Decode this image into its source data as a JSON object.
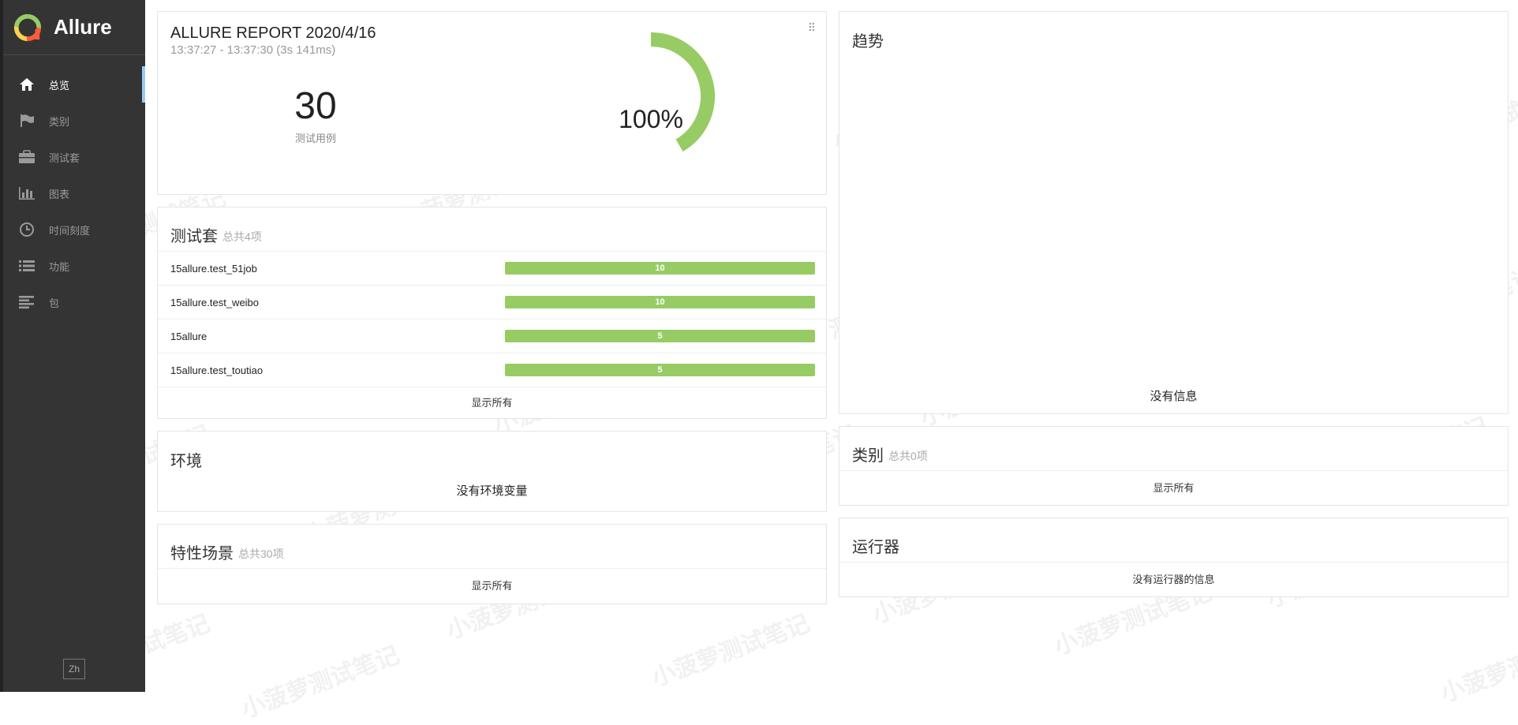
{
  "app": {
    "name": "Allure",
    "lang_button": "Zh"
  },
  "nav": [
    {
      "label": "总览",
      "icon": "home-icon",
      "active": true
    },
    {
      "label": "类别",
      "icon": "flag-icon"
    },
    {
      "label": "测试套",
      "icon": "briefcase-icon"
    },
    {
      "label": "图表",
      "icon": "bar-chart-icon"
    },
    {
      "label": "时间刻度",
      "icon": "clock-icon"
    },
    {
      "label": "功能",
      "icon": "list-icon"
    },
    {
      "label": "包",
      "icon": "align-left-icon"
    }
  ],
  "summary": {
    "title": "ALLURE REPORT 2020/4/16",
    "time": "13:37:27 - 13:37:30 (3s 141ms)",
    "count": "30",
    "count_label": "测试用例",
    "pass_percent": "100%",
    "pass_fraction": 1.0,
    "pass_color": "#97cc64"
  },
  "suites": {
    "title": "测试套",
    "subtitle": "总共4项",
    "rows": [
      {
        "name": "15allure.test_51job",
        "count": "10"
      },
      {
        "name": "15allure.test_weibo",
        "count": "10"
      },
      {
        "name": "15allure",
        "count": "5"
      },
      {
        "name": "15allure.test_toutiao",
        "count": "5"
      }
    ],
    "show_all": "显示所有"
  },
  "environment": {
    "title": "环境",
    "empty": "没有环境变量"
  },
  "features": {
    "title": "特性场景",
    "subtitle": "总共30项",
    "show_all": "显示所有"
  },
  "trend": {
    "title": "趋势",
    "empty": "没有信息"
  },
  "categories": {
    "title": "类别",
    "subtitle": "总共0项",
    "show_all": "显示所有"
  },
  "executors": {
    "title": "运行器",
    "empty": "没有运行器的信息"
  },
  "watermark": "小菠萝测试笔记"
}
